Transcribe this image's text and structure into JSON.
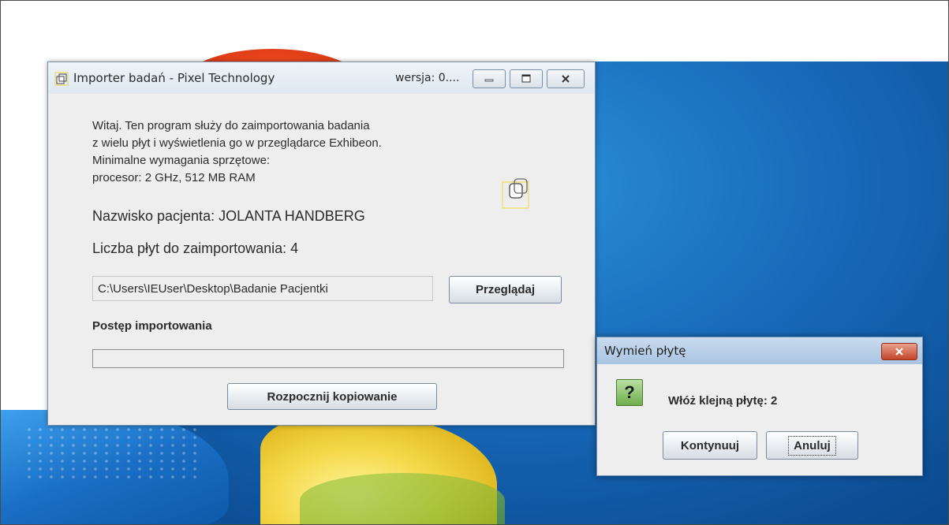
{
  "colors": {
    "desktop_blue": "#1768b8",
    "window_bg": "#eeeeee",
    "dialog_close_red": "#c4442a",
    "question_icon_green": "#6fae4b"
  },
  "main_window": {
    "title": "Importer badań - Pixel Technology",
    "version": "wersja: 0....",
    "controls": {
      "minimize_icon": "minimize-icon",
      "maximize_icon": "maximize-icon",
      "close_icon": "close-icon"
    },
    "intro_lines": [
      "Witaj. Ten program służy do zaimportowania badania",
      "z wielu płyt i wyświetlenia go w przeglądarce Exhibeon.",
      "Minimalne wymagania sprzętowe:",
      "procesor: 2 GHz, 512 MB RAM"
    ],
    "patient_label": "Nazwisko pacjenta: JOLANTA HANDBERG",
    "disc_count_label": "Liczba płyt do zaimportowania: 4",
    "path_value": "C:\\Users\\IEUser\\Desktop\\Badanie Pacjentki",
    "browse_button": "Przeglądaj",
    "progress_label": "Postęp importowania",
    "progress_fraction": 0,
    "start_button": "Rozpocznij kopiowanie"
  },
  "dialog": {
    "title": "Wymień płytę",
    "icon_glyph": "?",
    "message": "Włóż klejną płytę: 2",
    "continue_button": "Kontynuuj",
    "cancel_button": "Anuluj"
  }
}
